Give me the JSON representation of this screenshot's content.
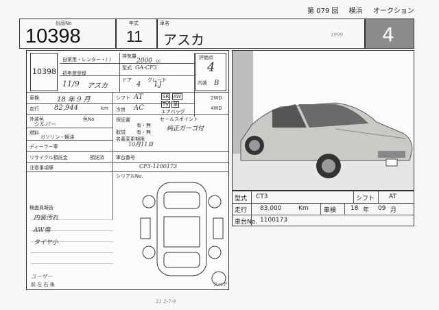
{
  "header": {
    "session": "第 079 回",
    "venue": "横浜",
    "event": "オークション"
  },
  "top": {
    "lot_label": "出品No",
    "lot_number": "10398",
    "year_label": "年式",
    "year": "11",
    "name_label": "車名",
    "model_name": "アスカ",
    "year_note": "1999",
    "grade": "4"
  },
  "sheet": {
    "lot_stamp": "10398",
    "usage_label": "自家用・レンター・(  )",
    "cc_label": "排気量",
    "cc": "2000",
    "cc_unit": "cc",
    "model_code_label": "型式",
    "model_code": "GA-CF3",
    "reg_label": "初年度登録",
    "reg": "11/9",
    "car_label": "車名",
    "car_name": "アスカ",
    "doors_label": "ドア",
    "doors": "4",
    "grade_label": "グレード",
    "grade_val": "LJ",
    "score_label": "評価点",
    "score": "4",
    "interior_label": "内装",
    "interior": "B",
    "drive2": "2WD",
    "drive4": "4WD",
    "inspect_label": "車検",
    "inspect": "18 年 9 月",
    "shift_label": "シフト",
    "shift": "AT",
    "mileage_label": "走行",
    "mileage": "82,944",
    "mileage_unit": "km",
    "color_label": "外装色",
    "color": "シルバー",
    "colorno_label": "色No",
    "fuel": "ガソリン・軽油",
    "ac_label": "冷房",
    "ac": "AC",
    "sunroof": "SR",
    "aw": "AW",
    "tv": "TV",
    "leather": "革",
    "airbag": "エアバッグ",
    "fuel_label": "燃料",
    "warranty_label": "保証書",
    "warranty": "有・無",
    "dealer_label": "ディーラー車",
    "manual_label": "取説",
    "manual": "有・無",
    "regdue_label": "名義変更期限",
    "regdue": "10月11日",
    "recycle_label": "リサイクル預託金",
    "recycle_note": "預託済",
    "chassis_label": "車台番号",
    "chassis": "CF3-1100173",
    "serial_label": "シリアルNo.",
    "selling_label": "セールスポイント",
    "selling_note": "純正ガーゴ付",
    "caution_label": "注意事項等",
    "inspector_label": "検査員報告",
    "report1": "内装汚れ",
    "report2": "AW傷",
    "report3": "タイヤ小",
    "spare": "スペア",
    "bottom_marks": "前  左  右  後",
    "footer_note": "21 2-7-9",
    "bottom_scribble": "ユーザー"
  },
  "specs": {
    "model_label": "型式",
    "model": "CT3",
    "shift_label": "シフト",
    "shift": "AT",
    "mileage_label": "走行",
    "mileage": "83,000",
    "mileage_unit": "Km",
    "inspect_label": "車検",
    "inspect_year": "18",
    "inspect_year_unit": "年",
    "inspect_month": "09",
    "inspect_month_unit": "月",
    "chassis_label": "車台No.",
    "chassis": "1100173"
  }
}
